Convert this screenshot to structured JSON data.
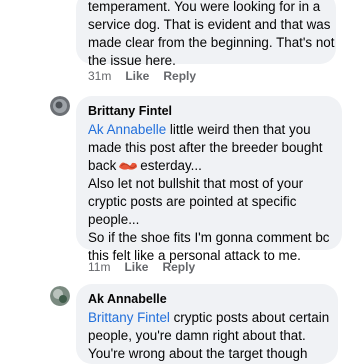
{
  "comment1": {
    "lines": [
      "temperament. You were looking for in a",
      "service dog. That is evident and that was",
      "made clear from the beginning. That's not",
      "the issue here."
    ],
    "time": "31m",
    "like": "Like",
    "reply": "Reply"
  },
  "comment2": {
    "author": "Brittany Fintel",
    "mention": "Ak Annabelle",
    "line1_rest": " little weird then that you",
    "line2": "made this post after the breeder bought",
    "line3_pre": "back",
    "line3_post": "esterday...",
    "line4": "Also let not bullshit that most of your",
    "line5": "cryptic posts are pointed at specific",
    "line6": "people...",
    "line7": "So if the shoe fits I'm gonna comment bc",
    "line8": "this felt like a personal attack to me.",
    "time": "11m",
    "like": "Like",
    "reply": "Reply"
  },
  "comment3": {
    "author": "Ak Annabelle",
    "mention": "Brittany Fintel",
    "line1_rest": " cryptic posts about certain",
    "line2": "people, you're damn right about that.",
    "line3": "You're wrong about the target though"
  },
  "colors": {
    "bubble": "#f0f2f5",
    "mention": "#216fdb",
    "meta": "#65676b",
    "scribble": "#e8573a"
  }
}
